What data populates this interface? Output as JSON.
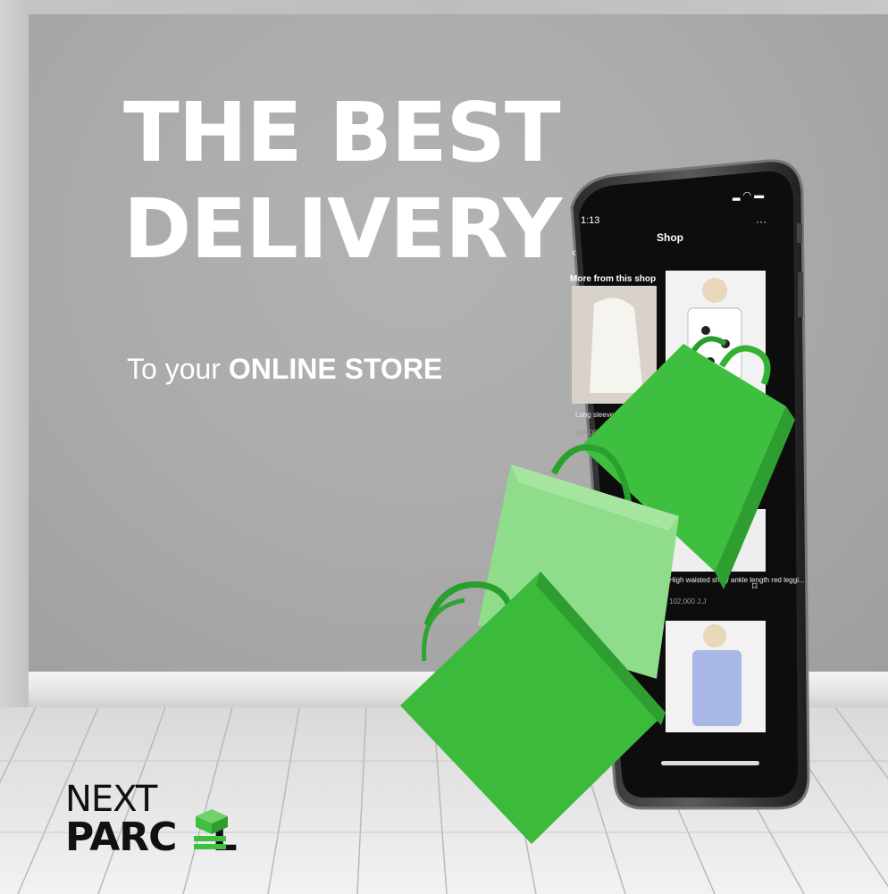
{
  "headline": {
    "line1": "THE BEST",
    "line2": "DELIVERY"
  },
  "tagline": {
    "prefix": "To your ",
    "emphasis": "ONLINE STORE"
  },
  "phone": {
    "time": "1:13",
    "title": "Shop",
    "section": "More from this shop",
    "product1": {
      "name": "Long sleeved loose backless white...",
      "price": "204,000 J.J"
    },
    "product2": {
      "name": "High waisted shiny ankle length red leggi...",
      "price": "102,000 J.J"
    }
  },
  "logo": {
    "line1": "NEXT",
    "line2_part1": "PARC",
    "line2_part2": "L"
  },
  "colors": {
    "green": "#3fbf3f",
    "bag_dark": "#34a935",
    "bag_light": "#8fdc8b",
    "wall": "#a9a9a9"
  }
}
